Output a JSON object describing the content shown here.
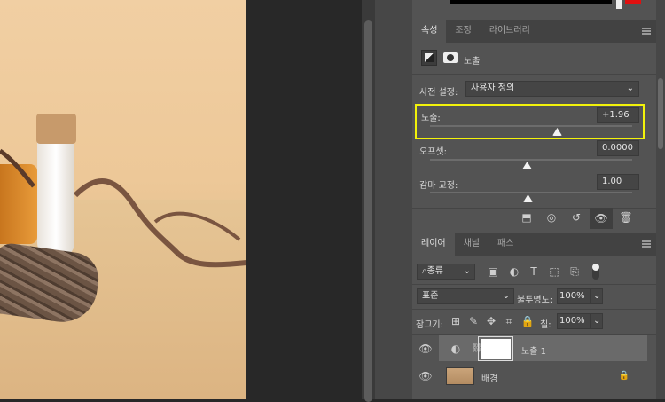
{
  "properties": {
    "tabs": [
      "속성",
      "조정",
      "라이브러리"
    ],
    "type_label": "노출",
    "preset_label": "사전 설정:",
    "preset_value": "사용자 정의",
    "exposure": {
      "label": "노출:",
      "value": "+1.96",
      "fraction": 0.73
    },
    "offset": {
      "label": "오프셋:",
      "value": "0.0000",
      "fraction": 0.5
    },
    "gamma": {
      "label": "감마 교정:",
      "value": "1.00",
      "fraction": 0.5
    }
  },
  "layers": {
    "tabs": [
      "레이어",
      "채널",
      "패스"
    ],
    "filter": "종류",
    "blend_mode": "표준",
    "opacity_label": "불투명도:",
    "opacity": "100%",
    "lock_label": "잠그기:",
    "fill_label": "칠:",
    "fill": "100%",
    "items": [
      {
        "name": "노출 1",
        "visible": true,
        "selected": true
      },
      {
        "name": "배경",
        "visible": true,
        "locked": true
      }
    ]
  },
  "colors": {
    "highlight": "#f2f20a",
    "swatch": "#e01010"
  }
}
